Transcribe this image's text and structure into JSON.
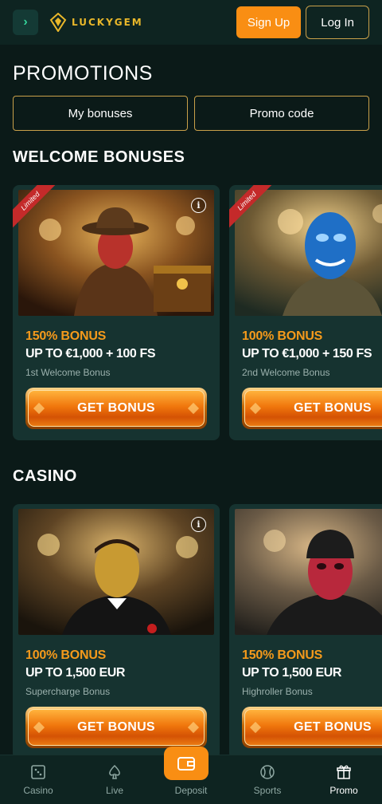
{
  "header": {
    "logo_text": "LUCKYGEM",
    "signup_label": "Sign Up",
    "login_label": "Log In"
  },
  "page": {
    "title": "PROMOTIONS",
    "tabs": [
      {
        "label": "My bonuses"
      },
      {
        "label": "Promo code"
      }
    ]
  },
  "sections": [
    {
      "title": "WELCOME BONUSES",
      "cards": [
        {
          "ribbon": "Limited",
          "percent": "150% BONUS",
          "amount": "UP TO €1,000 + 100 FS",
          "subtitle": "1st Welcome Bonus",
          "button": "GET BONUS",
          "image": "adventurer-with-treasure-chest"
        },
        {
          "ribbon": "Limited",
          "percent": "100% BONUS",
          "amount": "UP TO €1,000 + 150 FS",
          "subtitle": "2nd Welcome Bonus",
          "button": "GET BONUS",
          "image": "blue-crystal-face"
        }
      ]
    },
    {
      "title": "CASINO",
      "cards": [
        {
          "percent": "100% BONUS",
          "amount": "UP TO 1,500 EUR",
          "subtitle": "Supercharge Bonus",
          "button": "GET BONUS",
          "image": "gold-face-gentleman"
        },
        {
          "percent": "150% BONUS",
          "amount": "UP TO 1,500 EUR",
          "subtitle": "Highroller Bonus",
          "button": "GET BONUS",
          "image": "red-crystal-face-beanie"
        }
      ]
    }
  ],
  "bottom_nav": {
    "items": [
      {
        "label": "Casino",
        "icon": "dice-icon"
      },
      {
        "label": "Live",
        "icon": "spade-icon"
      },
      {
        "label": "Deposit",
        "icon": "wallet-icon"
      },
      {
        "label": "Sports",
        "icon": "ball-icon"
      },
      {
        "label": "Promo",
        "icon": "gift-icon"
      }
    ],
    "active": "Promo"
  },
  "colors": {
    "accent_orange": "#f98e13",
    "gold_border": "#c9a04a",
    "bonus_percent": "#f59a1b",
    "card_bg": "#163330",
    "page_bg": "#0b1a18"
  }
}
